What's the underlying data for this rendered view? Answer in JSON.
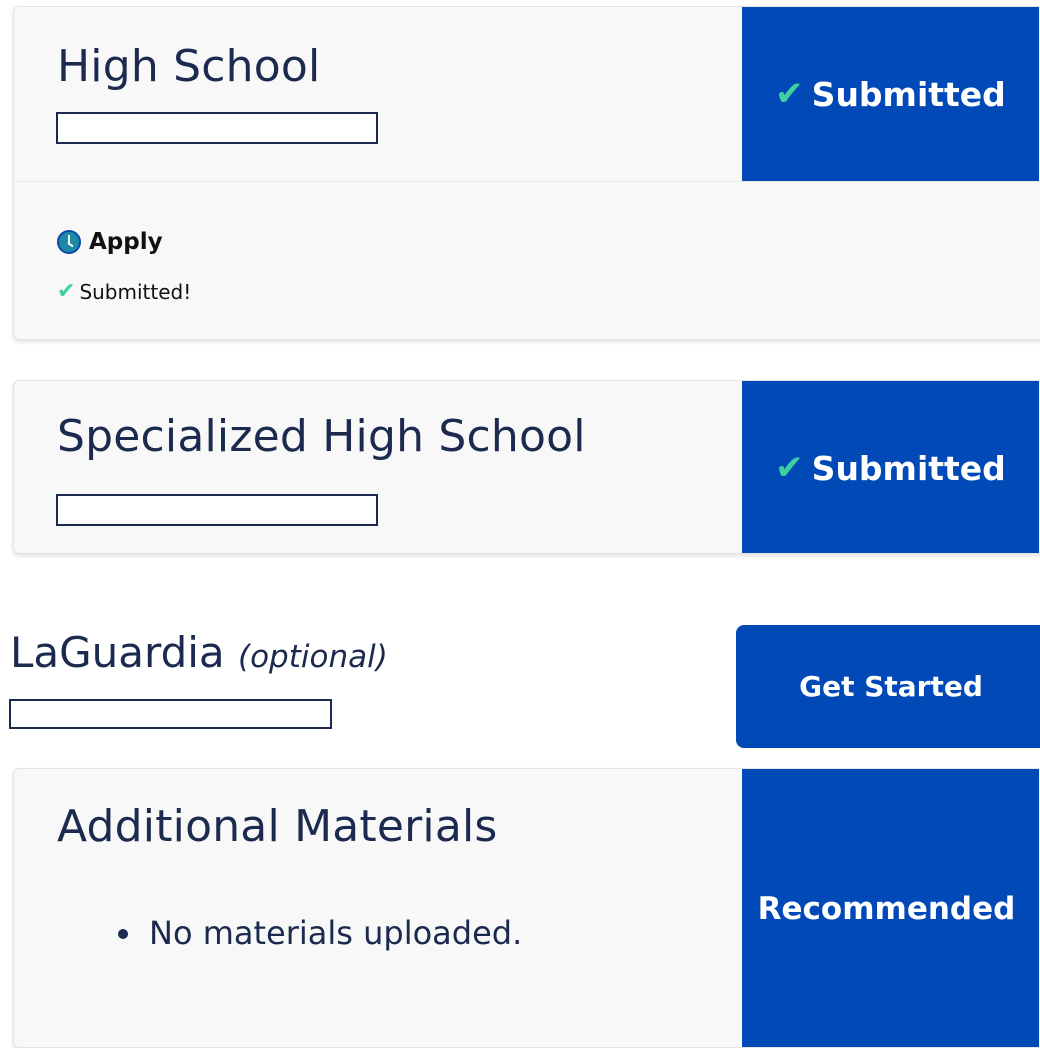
{
  "cards": {
    "high_school": {
      "title": "High School",
      "status": "Submitted",
      "apply_label": "Apply",
      "apply_status": "Submitted!"
    },
    "specialized": {
      "title": "Specialized High School",
      "status": "Submitted"
    },
    "laguardia": {
      "title": "LaGuardia",
      "title_note": "(optional)",
      "action_label": "Get Started"
    },
    "additional_materials": {
      "title": "Additional Materials",
      "status": "Recommended",
      "items": [
        "No materials uploaded."
      ]
    }
  },
  "colors": {
    "accent_blue": "#0249b8",
    "check_green": "#3fd0a0",
    "title_navy": "#1b2a4e"
  },
  "icons": {
    "check": "check-icon",
    "clock": "clock-icon"
  }
}
